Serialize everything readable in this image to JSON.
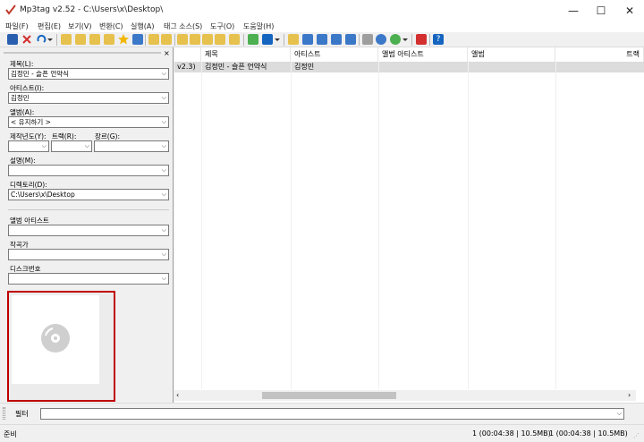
{
  "window": {
    "title": "Mp3tag v2.52  -  C:\\Users\\x\\Desktop\\",
    "min_label": "—",
    "max_label": "☐",
    "close_label": "✕"
  },
  "menu": [
    "파일(F)",
    "편집(E)",
    "보기(V)",
    "변환(C)",
    "실행(A)",
    "태그 소스(S)",
    "도구(O)",
    "도움말(H)"
  ],
  "panel": {
    "title": {
      "label": "제목(L):",
      "value": "김정민 - 슬픈 언약식"
    },
    "artist": {
      "label": "아티스트(I):",
      "value": "김정민"
    },
    "album": {
      "label": "앨범(A):",
      "value": "< 유지하기 >"
    },
    "year": {
      "label": "제작년도(Y):",
      "value": ""
    },
    "track": {
      "label": "트랙(R):",
      "value": ""
    },
    "genre": {
      "label": "장르(G):",
      "value": ""
    },
    "comment": {
      "label": "설명(M):",
      "value": ""
    },
    "directory": {
      "label": "디렉토리(D):",
      "value": "C:\\Users\\x\\Desktop"
    },
    "album_artist": {
      "label": "앨범 아티스트",
      "value": ""
    },
    "composer": {
      "label": "작곡가",
      "value": ""
    },
    "disc": {
      "label": "디스크번호",
      "value": ""
    }
  },
  "grid": {
    "columns": [
      "제목",
      "아티스트",
      "앨범 아티스트",
      "앨범",
      "트랙"
    ],
    "rows": [
      {
        "tagver": "v2.3)",
        "title": "김정민 - 슬픈 언약식",
        "artist": "김정민"
      }
    ]
  },
  "filter": {
    "label": "필터",
    "value": ""
  },
  "status": {
    "left": "준비",
    "selected": "1 (00:04:38 | 10.5MB)",
    "total": "1 (00:04:38 | 10.5MB)"
  }
}
